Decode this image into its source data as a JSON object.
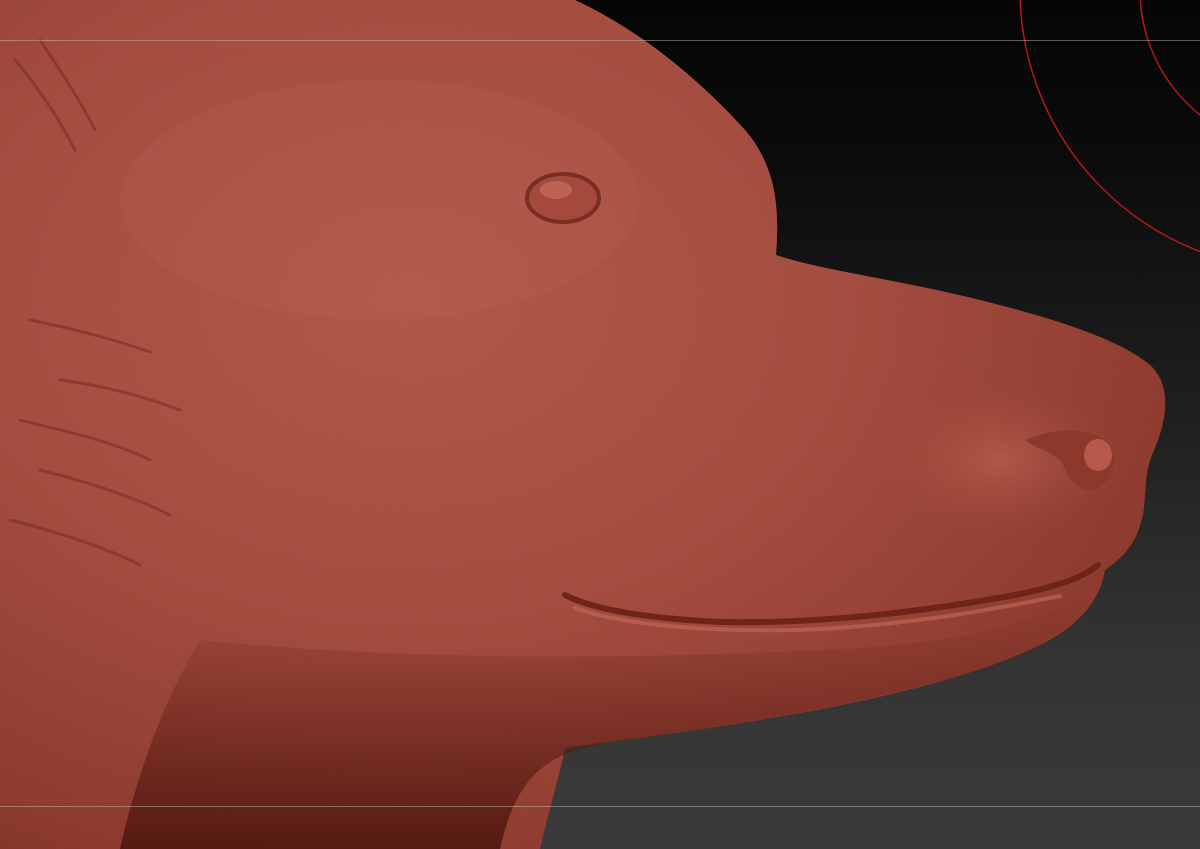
{
  "viewport": {
    "background_top": "#050505",
    "background_bottom": "#3a3a3a",
    "model_color": "#a6473a",
    "gizmo_color": "#b01818",
    "guide_color": "#c8c8c8"
  },
  "model": {
    "subject": "bear-head-sculpt"
  }
}
